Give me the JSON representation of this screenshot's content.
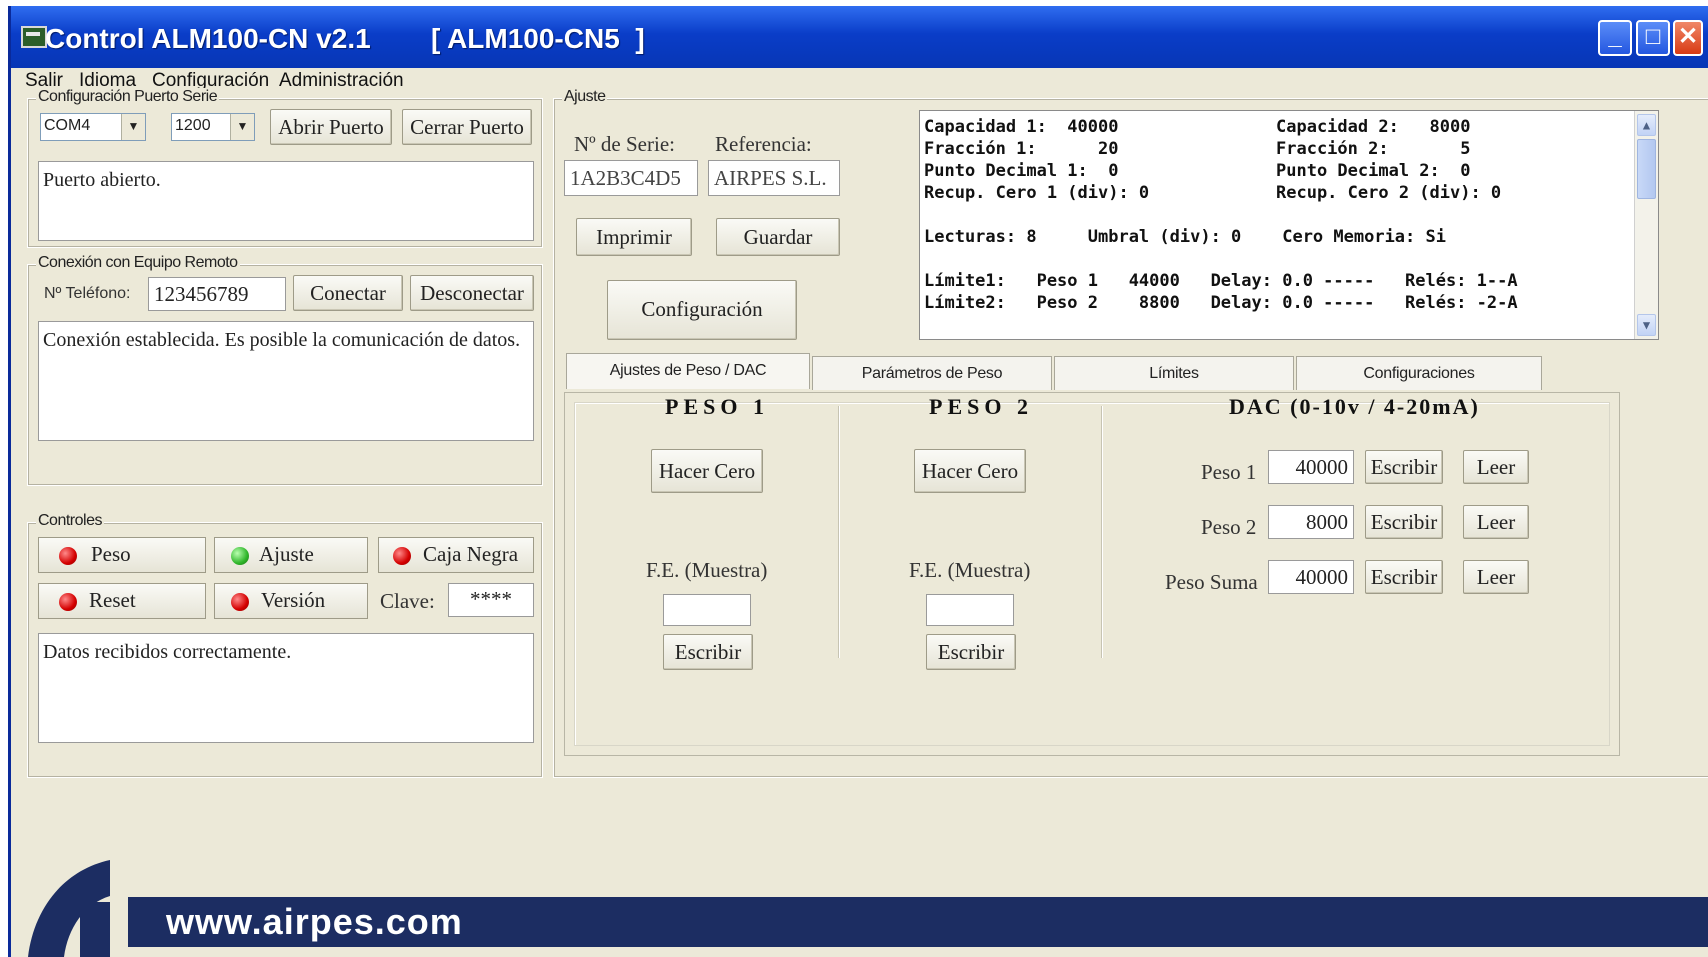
{
  "window": {
    "title": "Control ALM100-CN v2.1",
    "device": "[ ALM100-CN5  ]",
    "minimize_icon": "minimize-icon",
    "maximize_icon": "maximize-icon",
    "close_icon": "close-icon"
  },
  "menu": [
    "Salir",
    "Idioma",
    "Configuración",
    "Administración"
  ],
  "serial": {
    "group_title": "Configuración Puerto Serie",
    "port_value": "COM4",
    "baud_value": "1200",
    "open_label": "Abrir Puerto",
    "close_label": "Cerrar Puerto",
    "status_text": "Puerto abierto."
  },
  "remote": {
    "group_title": "Conexión con Equipo Remoto",
    "phone_label": "Nº Teléfono:",
    "phone_value": "123456789",
    "connect_label": "Conectar",
    "disconnect_label": "Desconectar",
    "status_text": "Conexión establecida. Es posible la comunicación de datos."
  },
  "controls": {
    "group_title": "Controles",
    "peso": {
      "label": "Peso",
      "led": "#d40000"
    },
    "ajuste": {
      "label": "Ajuste",
      "led": "#2fb62a"
    },
    "caja_negra": {
      "label": "Caja Negra",
      "led": "#d40000"
    },
    "reset": {
      "label": "Reset",
      "led": "#d40000"
    },
    "version": {
      "label": "Versión",
      "led": "#d40000"
    },
    "clave_label": "Clave:",
    "clave_value": "****",
    "status_text": "Datos recibidos correctamente."
  },
  "ajuste": {
    "group_title": "Ajuste",
    "serie_label": "Nº de Serie:",
    "serie_value": "1A2B3C4D5",
    "referencia_label": "Referencia:",
    "referencia_value": "AIRPES S.L.",
    "imprimir_label": "Imprimir",
    "guardar_label": "Guardar",
    "configuracion_label": "Configuración"
  },
  "info_lines": [
    "Capacidad 1:  40000",
    "Capacidad 2:   8000",
    "Fracción 1:      20",
    "Fracción 2:       5",
    "Punto Decimal 1:  0",
    "Punto Decimal 2:  0",
    "Recup. Cero 1 (div): 0",
    "Recup. Cero 2 (div): 0",
    "Lecturas: 8     Umbral (div): 0    Cero Memoria: Si",
    "Límite1:   Peso 1   44000   Delay: 0.0 -----   Relés: 1--A",
    "Límite2:   Peso 2    8800   Delay: 0.0 -----   Relés: -2-A"
  ],
  "tabs": [
    "Ajustes de Peso / DAC",
    "Parámetros de Peso",
    "Límites",
    "Configuraciones"
  ],
  "peso1": {
    "heading": "PESO 1",
    "zero_label": "Hacer Cero",
    "fe_label": "F.E. (Muestra)",
    "fe_value": "",
    "write_label": "Escribir"
  },
  "peso2": {
    "heading": "PESO 2",
    "zero_label": "Hacer Cero",
    "fe_label": "F.E. (Muestra)",
    "fe_value": "",
    "write_label": "Escribir"
  },
  "dac": {
    "heading": "DAC (0-10v / 4-20mA)",
    "rows": [
      {
        "label": "Peso 1",
        "value": "40000",
        "write": "Escribir",
        "read": "Leer"
      },
      {
        "label": "Peso 2",
        "value": "8000",
        "write": "Escribir",
        "read": "Leer"
      },
      {
        "label": "Peso Suma",
        "value": "40000",
        "write": "Escribir",
        "read": "Leer"
      }
    ]
  },
  "footer": {
    "url": "www.airpes.com",
    "brand_color": "#1c2d62"
  }
}
